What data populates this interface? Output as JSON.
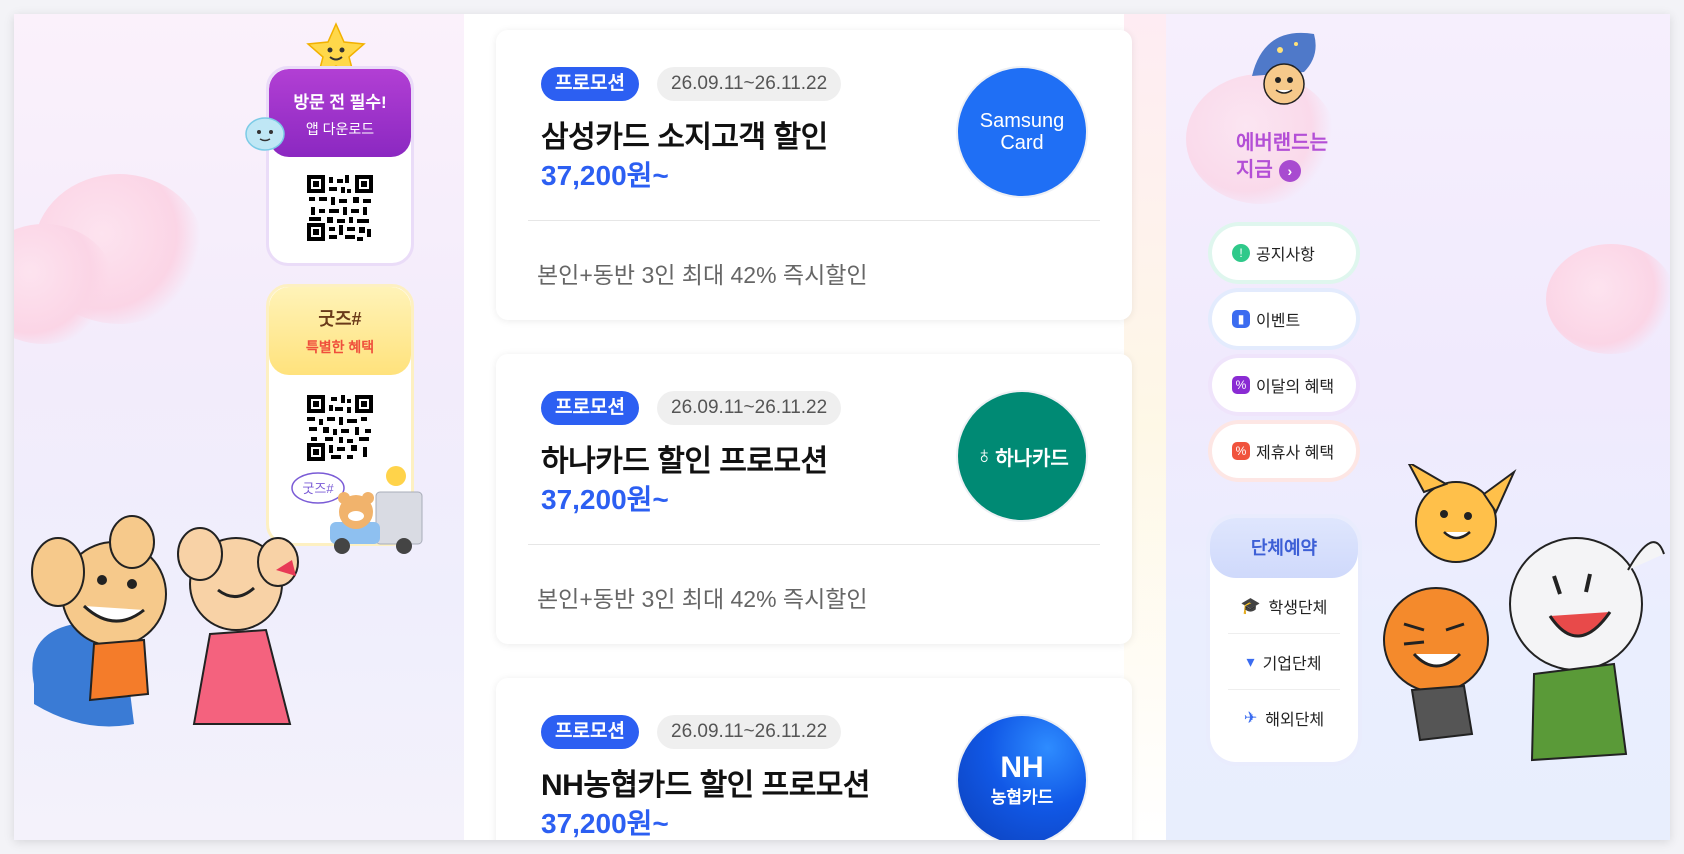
{
  "left_panel": {
    "app_card": {
      "title": "방문 전 필수!",
      "subtitle": "앱 다운로드"
    },
    "goods_card": {
      "title": "굿즈#",
      "subtitle": "특별한 혜택",
      "bubble": "굿즈#"
    }
  },
  "promotions": [
    {
      "tag": "프로모션",
      "dates": "26.09.11~26.11.22",
      "title": "삼성카드 소지고객 할인",
      "price": "37,200원~",
      "desc": "본인+동반 3인 최대 42% 즉시할인",
      "logo": {
        "line1": "Samsung",
        "line2": "Card"
      }
    },
    {
      "tag": "프로모션",
      "dates": "26.09.11~26.11.22",
      "title": "하나카드 할인 프로모션",
      "price": "37,200원~",
      "desc": "본인+동반 3인 최대 42% 즉시할인",
      "logo": {
        "line1": "하나카드"
      }
    },
    {
      "tag": "프로모션",
      "dates": "26.09.11~26.11.22",
      "title": "NH농협카드 할인 프로모션",
      "price": "37,200원~",
      "logo": {
        "line1": "NH",
        "line2": "농협카드"
      }
    }
  ],
  "right_panel": {
    "everland_now": {
      "line1": "에버랜드는",
      "line2": "지금",
      "arrow": "›"
    },
    "menu": [
      {
        "label": "공지사항",
        "icon": "notice-icon",
        "color": "#2fc98a"
      },
      {
        "label": "이벤트",
        "icon": "gift-icon",
        "color": "#3b6cf0"
      },
      {
        "label": "이달의 혜택",
        "icon": "coupon-icon",
        "color": "#8a2bd3"
      },
      {
        "label": "제휴사 혜택",
        "icon": "partner-icon",
        "color": "#f0533d"
      }
    ],
    "group_booking": {
      "title": "단체예약",
      "items": [
        {
          "label": "학생단체",
          "icon": "graduation-cap-icon"
        },
        {
          "label": "기업단체",
          "icon": "necktie-icon"
        },
        {
          "label": "해외단체",
          "icon": "airplane-icon"
        }
      ]
    }
  },
  "colors": {
    "accent": "#2c5ff2",
    "purple": "#b34fd6",
    "hana_green": "#008a74",
    "samsung_blue": "#1f6ff5"
  }
}
